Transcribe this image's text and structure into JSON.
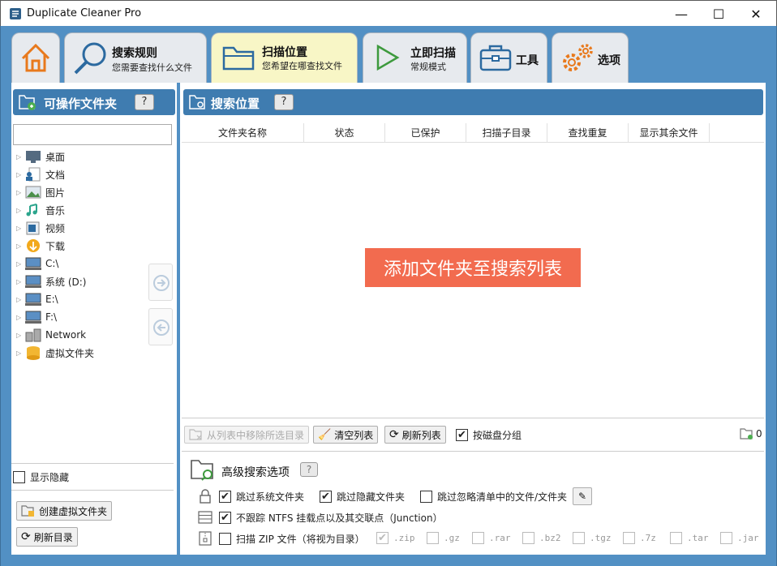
{
  "window": {
    "title": "Duplicate Cleaner Pro",
    "minimize": "—",
    "maximize": "☐",
    "close": "✕"
  },
  "tabs": [
    {
      "label": "",
      "sub": ""
    },
    {
      "label": "搜索规则",
      "sub": "您需要查找什么文件"
    },
    {
      "label": "扫描位置",
      "sub": "您希望在哪查找文件"
    },
    {
      "label": "立即扫描",
      "sub": "常规模式"
    },
    {
      "label": "工具",
      "sub": ""
    },
    {
      "label": "选项",
      "sub": ""
    }
  ],
  "left": {
    "header": "可操作文件夹",
    "help": "?",
    "search_value": "",
    "tree": [
      "桌面",
      "文档",
      "图片",
      "音乐",
      "视频",
      "下载",
      "C:\\",
      "系统 (D:)",
      "E:\\",
      "F:\\",
      "Network",
      "虚拟文件夹"
    ],
    "show_hidden": "显示隐藏",
    "create_virtual": "创建虚拟文件夹",
    "refresh_dir": "刷新目录"
  },
  "right": {
    "header": "搜索位置",
    "help": "?",
    "columns": [
      "文件夹名称",
      "状态",
      "已保护",
      "扫描子目录",
      "查找重复",
      "显示其余文件"
    ],
    "empty_hint": "添加文件夹至搜索列表",
    "remove_btn": "从列表中移除所选目录",
    "clear_btn": "清空列表",
    "refresh_btn": "刷新列表",
    "group_by_disk": "按磁盘分组",
    "folder_count": "0",
    "advanced_title": "高级搜索选项",
    "advanced_help": "?",
    "skip_system": "跳过系统文件夹",
    "skip_hidden": "跳过隐藏文件夹",
    "skip_ignore": "跳过忽略清单中的文件/文件夹",
    "no_ntfs": "不跟踪 NTFS 挂载点以及其交联点（Junction）",
    "scan_zip": "扫描 ZIP 文件（将视为目录）",
    "zip_exts": [
      ".zip",
      ".gz",
      ".rar",
      ".bz2",
      ".tgz",
      ".7z",
      ".tar",
      ".jar"
    ]
  },
  "colors": {
    "accent": "#3f7cb0",
    "frame": "#5290c4",
    "hint_bg": "#f26b4f",
    "active_tab": "#f8f6c6"
  }
}
